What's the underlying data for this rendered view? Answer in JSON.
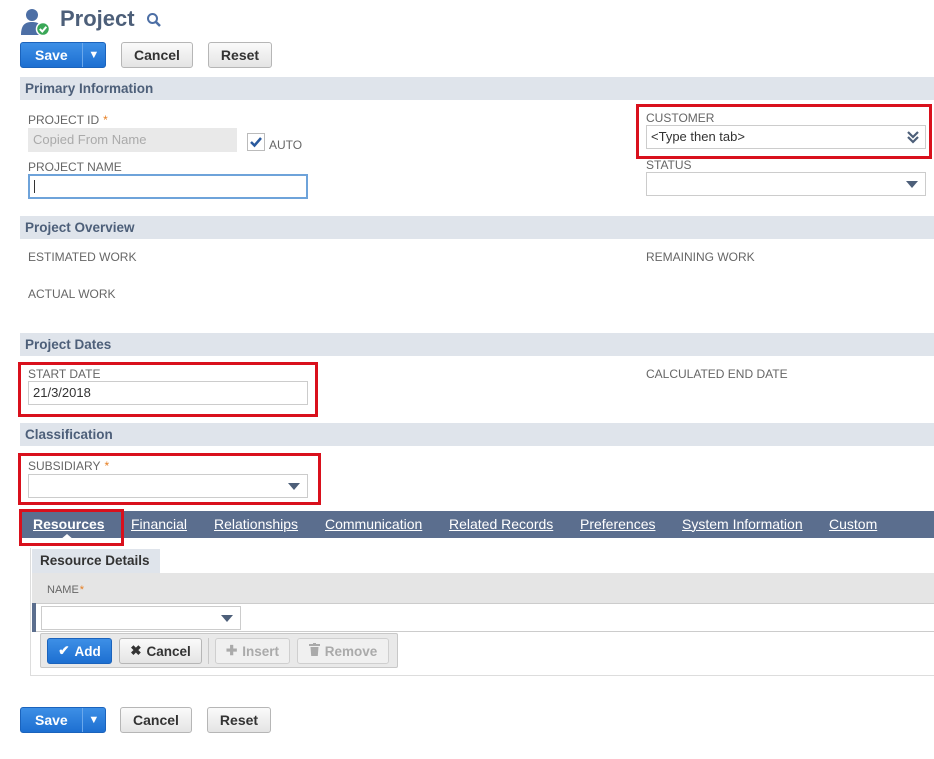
{
  "page": {
    "title": "Project"
  },
  "toolbar": {
    "save": "Save",
    "cancel": "Cancel",
    "reset": "Reset"
  },
  "sections": {
    "primary": "Primary Information",
    "overview": "Project Overview",
    "dates": "Project Dates",
    "classification": "Classification"
  },
  "fields": {
    "project_id": {
      "label": "PROJECT ID",
      "required": "*",
      "value": "Copied From Name"
    },
    "auto": {
      "label": "AUTO",
      "checked": true
    },
    "project_name": {
      "label": "PROJECT NAME",
      "value": ""
    },
    "customer": {
      "label": "CUSTOMER",
      "value": "<Type then tab>"
    },
    "status": {
      "label": "STATUS",
      "value": ""
    },
    "estimated_work": {
      "label": "ESTIMATED WORK"
    },
    "remaining_work": {
      "label": "REMAINING WORK"
    },
    "actual_work": {
      "label": "ACTUAL WORK"
    },
    "start_date": {
      "label": "START DATE",
      "value": "21/3/2018"
    },
    "calc_end_date": {
      "label": "CALCULATED END DATE"
    },
    "subsidiary": {
      "label": "SUBSIDIARY",
      "required": "*",
      "value": ""
    }
  },
  "tabs": [
    {
      "label": "Resources",
      "active": true
    },
    {
      "label": "Financial"
    },
    {
      "label": "Relationships"
    },
    {
      "label": "Communication"
    },
    {
      "label": "Related Records"
    },
    {
      "label": "Preferences"
    },
    {
      "label": "System Information"
    },
    {
      "label": "Custom"
    }
  ],
  "resources": {
    "subtab": "Resource Details",
    "name_col": "NAME",
    "required": "*",
    "buttons": {
      "add": "Add",
      "cancel": "Cancel",
      "insert": "Insert",
      "remove": "Remove"
    }
  },
  "colors": {
    "accent": "#1d6fd1",
    "section_bg": "#dfe4eb",
    "tabbar": "#5b6e8e",
    "highlight": "#d9101c",
    "required": "#e67e22"
  }
}
